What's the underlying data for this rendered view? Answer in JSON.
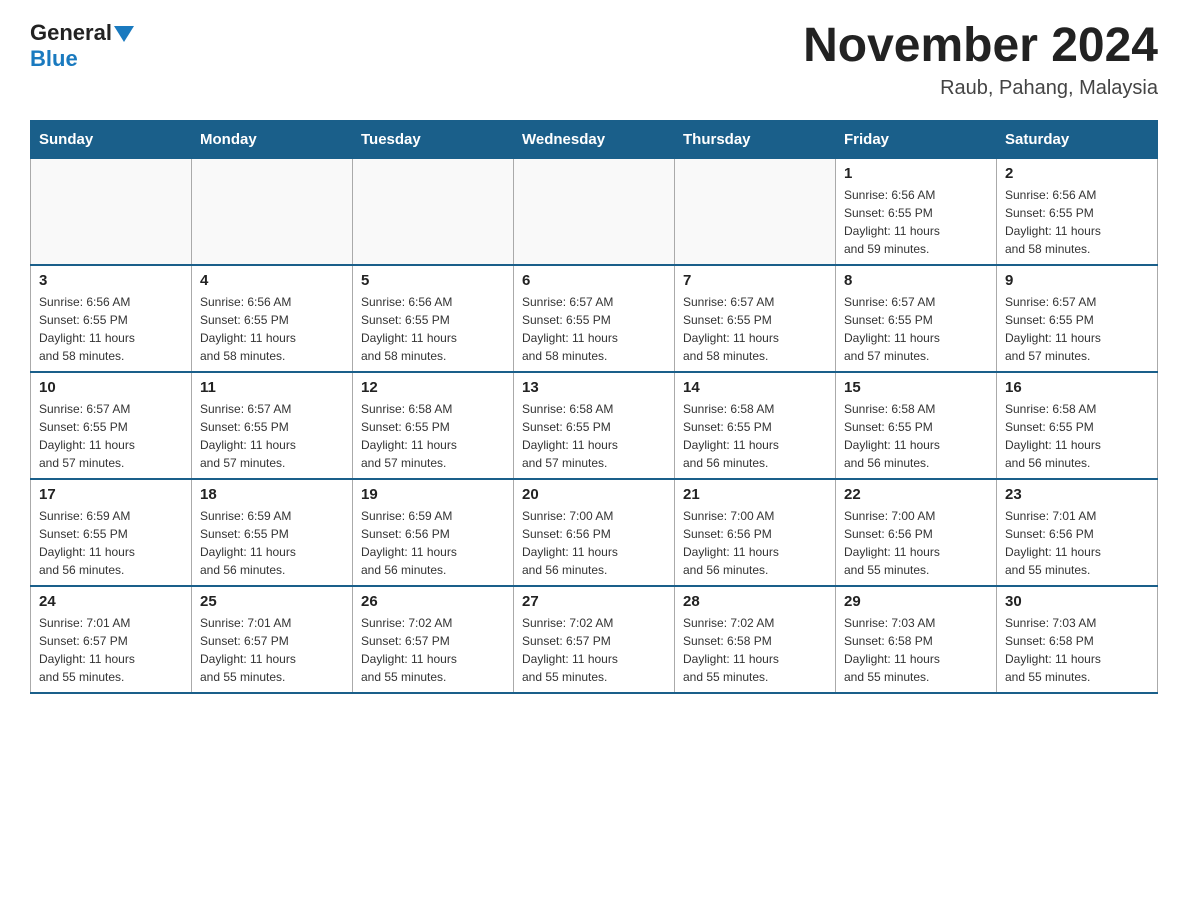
{
  "header": {
    "logo_general": "General",
    "logo_blue": "Blue",
    "month_title": "November 2024",
    "location": "Raub, Pahang, Malaysia"
  },
  "calendar": {
    "days_of_week": [
      "Sunday",
      "Monday",
      "Tuesday",
      "Wednesday",
      "Thursday",
      "Friday",
      "Saturday"
    ],
    "weeks": [
      [
        {
          "day": "",
          "info": ""
        },
        {
          "day": "",
          "info": ""
        },
        {
          "day": "",
          "info": ""
        },
        {
          "day": "",
          "info": ""
        },
        {
          "day": "",
          "info": ""
        },
        {
          "day": "1",
          "info": "Sunrise: 6:56 AM\nSunset: 6:55 PM\nDaylight: 11 hours\nand 59 minutes."
        },
        {
          "day": "2",
          "info": "Sunrise: 6:56 AM\nSunset: 6:55 PM\nDaylight: 11 hours\nand 58 minutes."
        }
      ],
      [
        {
          "day": "3",
          "info": "Sunrise: 6:56 AM\nSunset: 6:55 PM\nDaylight: 11 hours\nand 58 minutes."
        },
        {
          "day": "4",
          "info": "Sunrise: 6:56 AM\nSunset: 6:55 PM\nDaylight: 11 hours\nand 58 minutes."
        },
        {
          "day": "5",
          "info": "Sunrise: 6:56 AM\nSunset: 6:55 PM\nDaylight: 11 hours\nand 58 minutes."
        },
        {
          "day": "6",
          "info": "Sunrise: 6:57 AM\nSunset: 6:55 PM\nDaylight: 11 hours\nand 58 minutes."
        },
        {
          "day": "7",
          "info": "Sunrise: 6:57 AM\nSunset: 6:55 PM\nDaylight: 11 hours\nand 58 minutes."
        },
        {
          "day": "8",
          "info": "Sunrise: 6:57 AM\nSunset: 6:55 PM\nDaylight: 11 hours\nand 57 minutes."
        },
        {
          "day": "9",
          "info": "Sunrise: 6:57 AM\nSunset: 6:55 PM\nDaylight: 11 hours\nand 57 minutes."
        }
      ],
      [
        {
          "day": "10",
          "info": "Sunrise: 6:57 AM\nSunset: 6:55 PM\nDaylight: 11 hours\nand 57 minutes."
        },
        {
          "day": "11",
          "info": "Sunrise: 6:57 AM\nSunset: 6:55 PM\nDaylight: 11 hours\nand 57 minutes."
        },
        {
          "day": "12",
          "info": "Sunrise: 6:58 AM\nSunset: 6:55 PM\nDaylight: 11 hours\nand 57 minutes."
        },
        {
          "day": "13",
          "info": "Sunrise: 6:58 AM\nSunset: 6:55 PM\nDaylight: 11 hours\nand 57 minutes."
        },
        {
          "day": "14",
          "info": "Sunrise: 6:58 AM\nSunset: 6:55 PM\nDaylight: 11 hours\nand 56 minutes."
        },
        {
          "day": "15",
          "info": "Sunrise: 6:58 AM\nSunset: 6:55 PM\nDaylight: 11 hours\nand 56 minutes."
        },
        {
          "day": "16",
          "info": "Sunrise: 6:58 AM\nSunset: 6:55 PM\nDaylight: 11 hours\nand 56 minutes."
        }
      ],
      [
        {
          "day": "17",
          "info": "Sunrise: 6:59 AM\nSunset: 6:55 PM\nDaylight: 11 hours\nand 56 minutes."
        },
        {
          "day": "18",
          "info": "Sunrise: 6:59 AM\nSunset: 6:55 PM\nDaylight: 11 hours\nand 56 minutes."
        },
        {
          "day": "19",
          "info": "Sunrise: 6:59 AM\nSunset: 6:56 PM\nDaylight: 11 hours\nand 56 minutes."
        },
        {
          "day": "20",
          "info": "Sunrise: 7:00 AM\nSunset: 6:56 PM\nDaylight: 11 hours\nand 56 minutes."
        },
        {
          "day": "21",
          "info": "Sunrise: 7:00 AM\nSunset: 6:56 PM\nDaylight: 11 hours\nand 56 minutes."
        },
        {
          "day": "22",
          "info": "Sunrise: 7:00 AM\nSunset: 6:56 PM\nDaylight: 11 hours\nand 55 minutes."
        },
        {
          "day": "23",
          "info": "Sunrise: 7:01 AM\nSunset: 6:56 PM\nDaylight: 11 hours\nand 55 minutes."
        }
      ],
      [
        {
          "day": "24",
          "info": "Sunrise: 7:01 AM\nSunset: 6:57 PM\nDaylight: 11 hours\nand 55 minutes."
        },
        {
          "day": "25",
          "info": "Sunrise: 7:01 AM\nSunset: 6:57 PM\nDaylight: 11 hours\nand 55 minutes."
        },
        {
          "day": "26",
          "info": "Sunrise: 7:02 AM\nSunset: 6:57 PM\nDaylight: 11 hours\nand 55 minutes."
        },
        {
          "day": "27",
          "info": "Sunrise: 7:02 AM\nSunset: 6:57 PM\nDaylight: 11 hours\nand 55 minutes."
        },
        {
          "day": "28",
          "info": "Sunrise: 7:02 AM\nSunset: 6:58 PM\nDaylight: 11 hours\nand 55 minutes."
        },
        {
          "day": "29",
          "info": "Sunrise: 7:03 AM\nSunset: 6:58 PM\nDaylight: 11 hours\nand 55 minutes."
        },
        {
          "day": "30",
          "info": "Sunrise: 7:03 AM\nSunset: 6:58 PM\nDaylight: 11 hours\nand 55 minutes."
        }
      ]
    ]
  }
}
